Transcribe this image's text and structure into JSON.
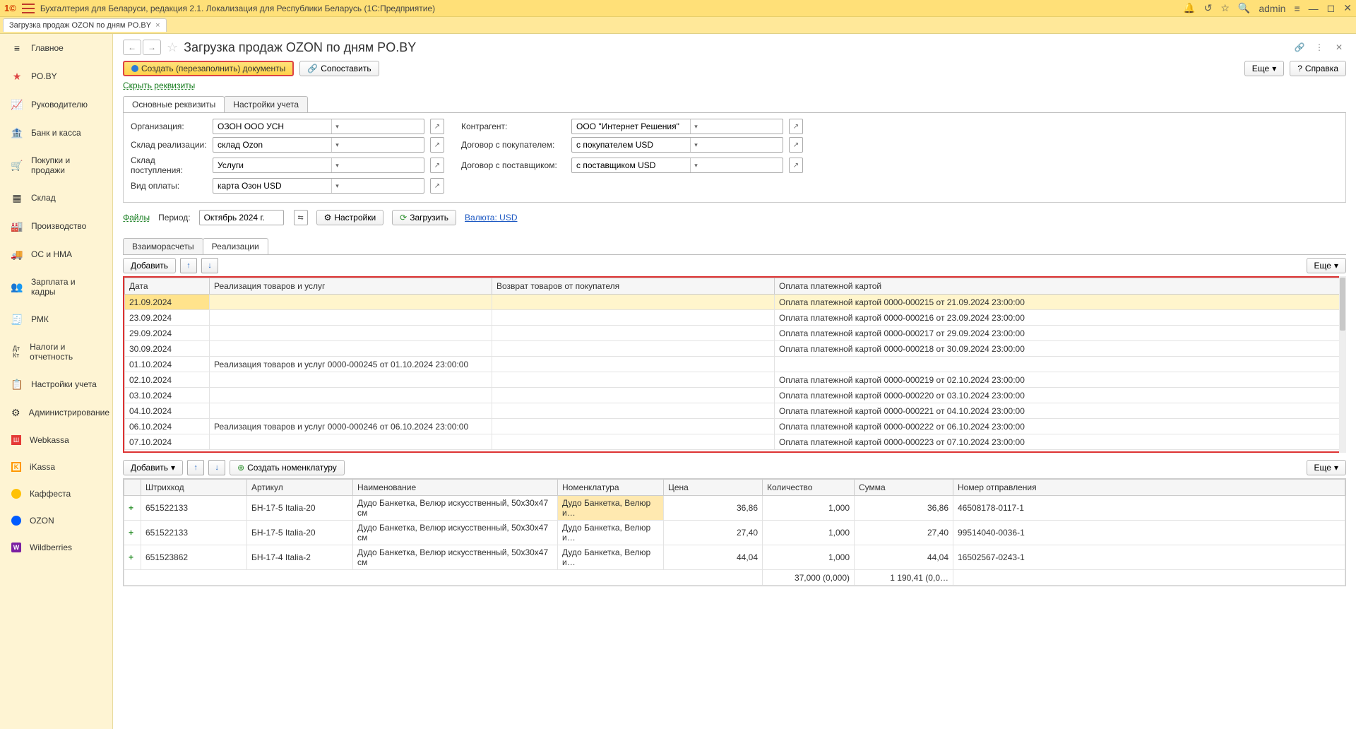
{
  "titlebar": {
    "app_title": "Бухгалтерия для Беларуси, редакция 2.1. Локализация для Республики Беларусь   (1С:Предприятие)",
    "user": "admin"
  },
  "tab": {
    "title": "Загрузка продаж OZON по дням PO.BY"
  },
  "sidebar": {
    "items": [
      {
        "label": "Главное"
      },
      {
        "label": "PO.BY"
      },
      {
        "label": "Руководителю"
      },
      {
        "label": "Банк и касса"
      },
      {
        "label": "Покупки и продажи"
      },
      {
        "label": "Склад"
      },
      {
        "label": "Производство"
      },
      {
        "label": "ОС и НМА"
      },
      {
        "label": "Зарплата и кадры"
      },
      {
        "label": "РМК"
      },
      {
        "label": "Налоги и отчетность"
      },
      {
        "label": "Настройки учета"
      },
      {
        "label": "Администрирование"
      },
      {
        "label": "Webkassa"
      },
      {
        "label": "iKassa"
      },
      {
        "label": "Каффеста"
      },
      {
        "label": "OZON"
      },
      {
        "label": "Wildberries"
      }
    ]
  },
  "page": {
    "title": "Загрузка продаж OZON по дням PO.BY",
    "create_btn": "Создать (перезаполнить) документы",
    "compare_btn": "Сопоставить",
    "more_btn": "Еще",
    "help_btn": "Справка",
    "hide_link": "Скрыть реквизиты"
  },
  "tabs_form": {
    "t1": "Основные реквизиты",
    "t2": "Настройки учета"
  },
  "form": {
    "org_label": "Организация:",
    "org_value": "ОЗОН ООО УСН",
    "sklad_real_label": "Склад реализации:",
    "sklad_real_value": "склад Ozon",
    "sklad_post_label": "Склад поступления:",
    "sklad_post_value": "Услуги",
    "vid_oplaty_label": "Вид оплаты:",
    "vid_oplaty_value": "карта Озон USD",
    "kontragent_label": "Контрагент:",
    "kontragent_value": "ООО \"Интернет Решения\"",
    "dogovor_pok_label": "Договор с покупателем:",
    "dogovor_pok_value": "с покупателем USD",
    "dogovor_post_label": "Договор с поставщиком:",
    "dogovor_post_value": "с поставщиком USD"
  },
  "period_row": {
    "files": "Файлы",
    "period_label": "Период:",
    "period_value": "Октябрь 2024 г.",
    "settings_btn": "Настройки",
    "load_btn": "Загрузить",
    "currency": "Валюта: USD"
  },
  "tabs2": {
    "t1": "Взаиморасчеты",
    "t2": "Реализации"
  },
  "table1": {
    "add_btn": "Добавить",
    "more_btn": "Еще",
    "cols": {
      "date": "Дата",
      "real": "Реализация товаров и услуг",
      "return": "Возврат товаров от покупателя",
      "payment": "Оплата платежной картой"
    },
    "rows": [
      {
        "date": "21.09.2024",
        "real": "",
        "ret": "",
        "pay": "Оплата платежной картой 0000-000215 от 21.09.2024 23:00:00"
      },
      {
        "date": "23.09.2024",
        "real": "",
        "ret": "",
        "pay": "Оплата платежной картой 0000-000216 от 23.09.2024 23:00:00"
      },
      {
        "date": "29.09.2024",
        "real": "",
        "ret": "",
        "pay": "Оплата платежной картой 0000-000217 от 29.09.2024 23:00:00"
      },
      {
        "date": "30.09.2024",
        "real": "",
        "ret": "",
        "pay": "Оплата платежной картой 0000-000218 от 30.09.2024 23:00:00"
      },
      {
        "date": "01.10.2024",
        "real": "Реализация товаров и услуг 0000-000245 от 01.10.2024 23:00:00",
        "ret": "",
        "pay": ""
      },
      {
        "date": "02.10.2024",
        "real": "",
        "ret": "",
        "pay": "Оплата платежной картой 0000-000219 от 02.10.2024 23:00:00"
      },
      {
        "date": "03.10.2024",
        "real": "",
        "ret": "",
        "pay": "Оплата платежной картой 0000-000220 от 03.10.2024 23:00:00"
      },
      {
        "date": "04.10.2024",
        "real": "",
        "ret": "",
        "pay": "Оплата платежной картой 0000-000221 от 04.10.2024 23:00:00"
      },
      {
        "date": "06.10.2024",
        "real": "Реализация товаров и услуг 0000-000246 от 06.10.2024 23:00:00",
        "ret": "",
        "pay": "Оплата платежной картой 0000-000222 от 06.10.2024 23:00:00"
      },
      {
        "date": "07.10.2024",
        "real": "",
        "ret": "",
        "pay": "Оплата платежной картой 0000-000223 от 07.10.2024 23:00:00"
      }
    ]
  },
  "table2": {
    "add_btn": "Добавить",
    "create_nom_btn": "Создать номенклатуру",
    "more_btn": "Еще",
    "cols": {
      "barcode": "Штрихкод",
      "article": "Артикул",
      "name": "Наименование",
      "nomen": "Номенклатура",
      "price": "Цена",
      "qty": "Количество",
      "sum": "Сумма",
      "shipment": "Номер отправления"
    },
    "rows": [
      {
        "barcode": "651522133",
        "article": "БН-17-5 Italia-20",
        "name": "Дудо Банкетка, Велюр искусственный, 50x30x47 см",
        "nomen": "Дудо Банкетка, Велюр и…",
        "price": "36,86",
        "qty": "1,000",
        "sum": "36,86",
        "ship": "46508178-0117-1"
      },
      {
        "barcode": "651522133",
        "article": "БН-17-5 Italia-20",
        "name": "Дудо Банкетка, Велюр искусственный, 50x30x47 см",
        "nomen": "Дудо Банкетка, Велюр и…",
        "price": "27,40",
        "qty": "1,000",
        "sum": "27,40",
        "ship": "99514040-0036-1"
      },
      {
        "barcode": "651523862",
        "article": "БН-17-4 Italia-2",
        "name": "Дудо Банкетка, Велюр искусственный, 50x30x47 см",
        "nomen": "Дудо Банкетка, Велюр и…",
        "price": "44,04",
        "qty": "1,000",
        "sum": "44,04",
        "ship": "16502567-0243-1"
      }
    ],
    "totals": {
      "qty": "37,000 (0,000)",
      "sum": "1 190,41 (0,0…"
    }
  }
}
